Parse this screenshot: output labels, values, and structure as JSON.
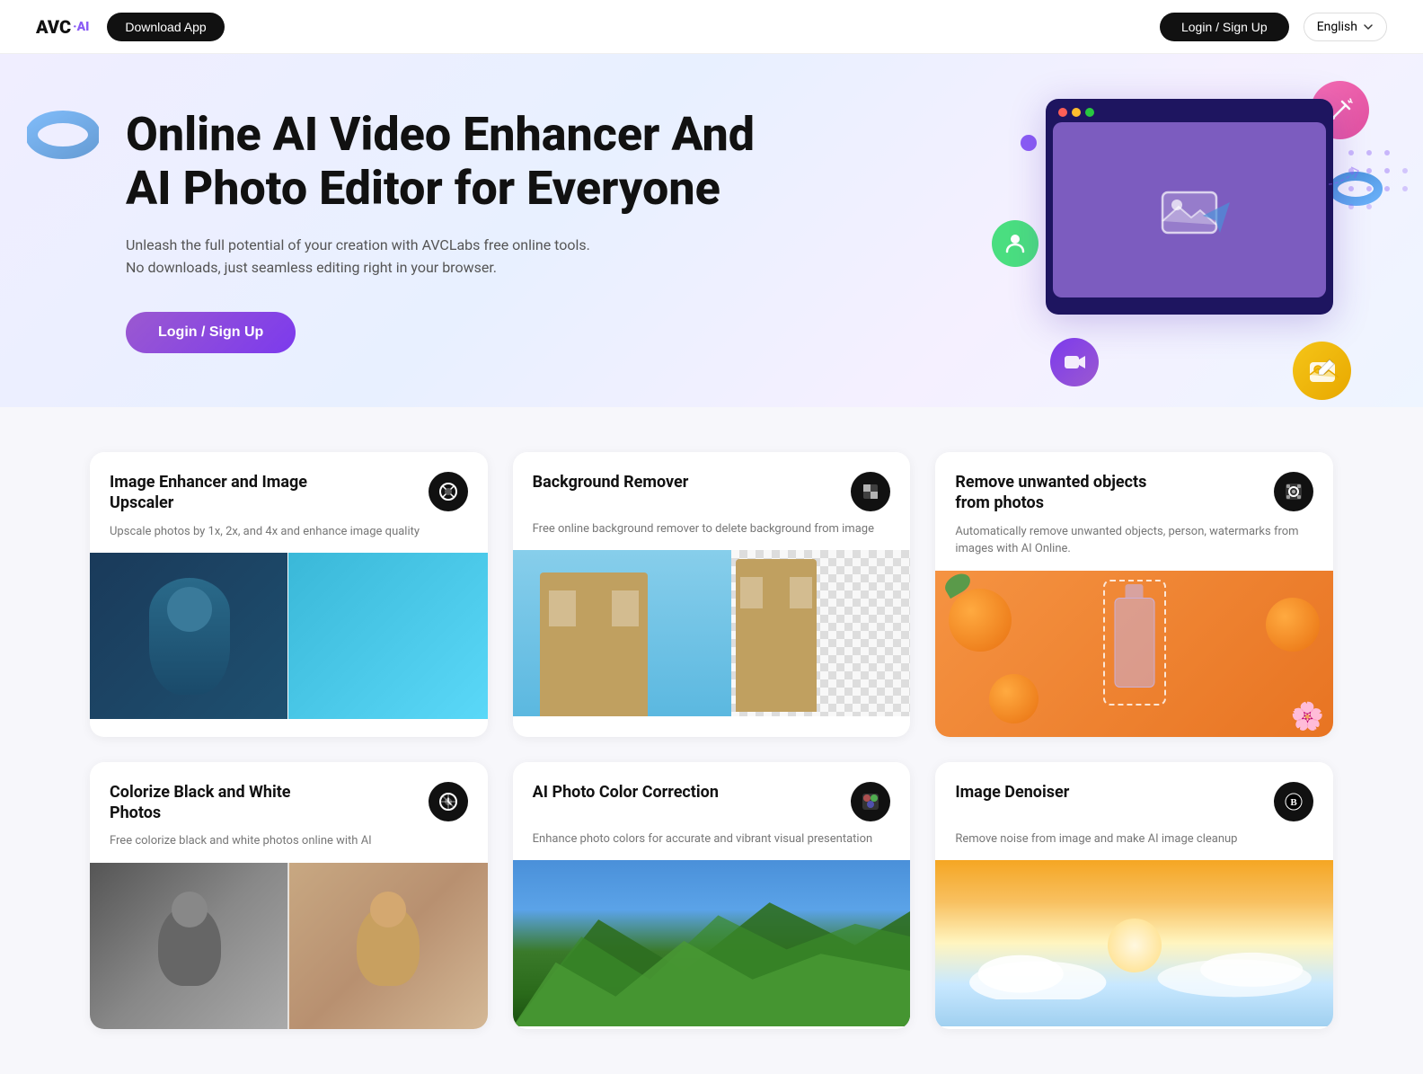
{
  "navbar": {
    "logo_text": "AVC·AI",
    "download_label": "Download App",
    "login_label": "Login / Sign Up",
    "language": "English",
    "lang_chevron": "▾"
  },
  "hero": {
    "title": "Online AI Video Enhancer And AI Photo Editor for Everyone",
    "subtitle": "Unleash the full potential of your creation with AVCLabs free online tools. No downloads, just seamless editing right in your browser.",
    "cta_label": "Login / Sign Up"
  },
  "cards": [
    {
      "id": "image-enhancer",
      "title": "Image Enhancer and Image Upscaler",
      "description": "Upscale photos by 1x, 2x, and 4x and enhance image quality",
      "icon": "enhance"
    },
    {
      "id": "bg-remover",
      "title": "Background Remover",
      "description": "Free online background remover to delete background from image",
      "icon": "bg-remove"
    },
    {
      "id": "object-removal",
      "title": "Remove unwanted objects from photos",
      "description": "Automatically remove unwanted objects, person, watermarks from images with AI Online.",
      "icon": "object-remove"
    },
    {
      "id": "colorize",
      "title": "Colorize Black and White Photos",
      "description": "Free colorize black and white photos online with AI",
      "icon": "colorize"
    },
    {
      "id": "color-correction",
      "title": "AI Photo Color Correction",
      "description": "Enhance photo colors for accurate and vibrant visual presentation",
      "icon": "color-correction"
    },
    {
      "id": "denoiser",
      "title": "Image Denoiser",
      "description": "Remove noise from image and make AI image cleanup",
      "icon": "denoiser"
    }
  ]
}
